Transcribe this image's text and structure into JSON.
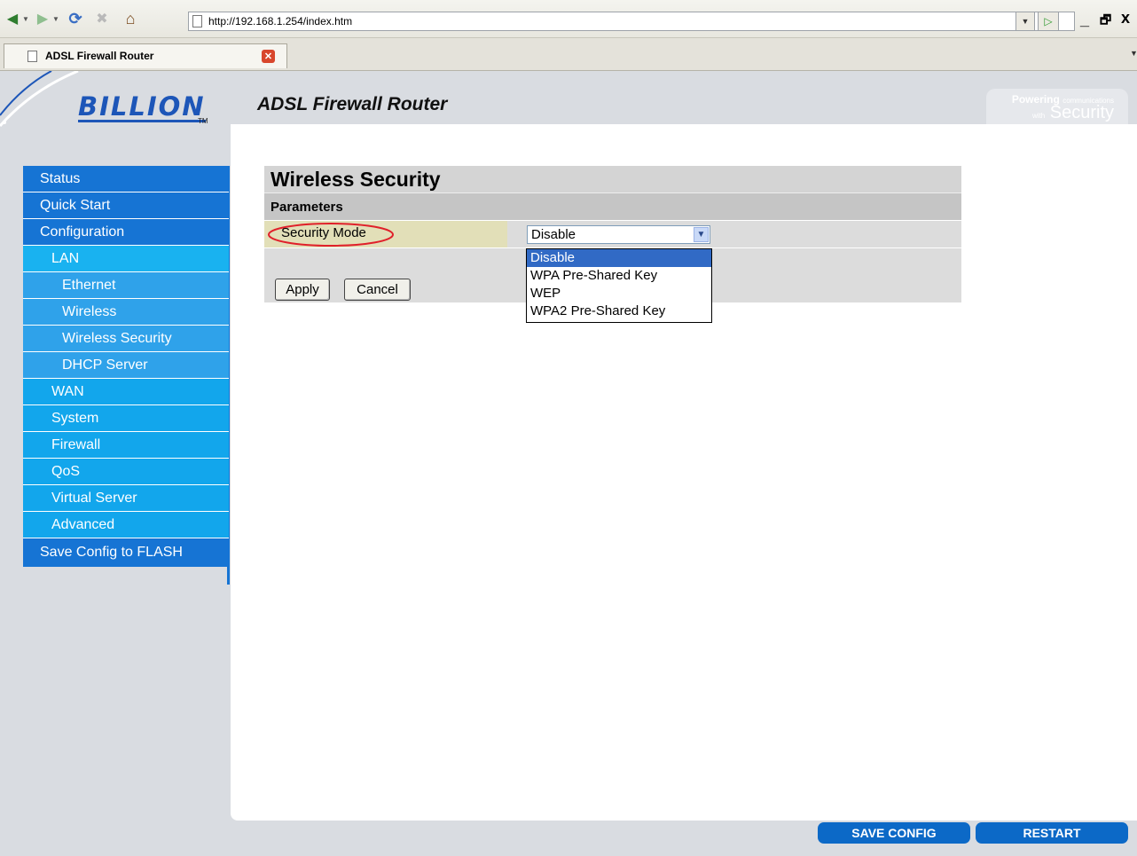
{
  "browser": {
    "url": "http://192.168.1.254/index.htm",
    "tab_title": "ADSL Firewall Router",
    "window_controls": {
      "minimize": "_",
      "maximize": "🗗",
      "close": "x"
    }
  },
  "header": {
    "logo": "BILLION",
    "logo_tm": "TM",
    "title": "ADSL Firewall Router",
    "slogan_line1_big": "Powering",
    "slogan_line1_small": "communications",
    "slogan_line2_small": "with",
    "slogan_line2_big": "Security"
  },
  "sidebar": {
    "items": [
      {
        "label": "Status"
      },
      {
        "label": "Quick Start"
      },
      {
        "label": "Configuration"
      },
      {
        "label": "LAN"
      },
      {
        "label": "Ethernet"
      },
      {
        "label": "Wireless"
      },
      {
        "label": "Wireless Security"
      },
      {
        "label": "DHCP Server"
      },
      {
        "label": "WAN"
      },
      {
        "label": "System"
      },
      {
        "label": "Firewall"
      },
      {
        "label": "QoS"
      },
      {
        "label": "Virtual Server"
      },
      {
        "label": "Advanced"
      },
      {
        "label": "Save Config to FLASH"
      }
    ]
  },
  "main": {
    "section_title": "Wireless Security",
    "parameters_heading": "Parameters",
    "security_mode_label": "Security Mode",
    "security_mode_value": "Disable",
    "options": [
      "Disable",
      "WPA Pre-Shared Key",
      "WEP",
      "WPA2 Pre-Shared Key"
    ],
    "apply_label": "Apply",
    "cancel_label": "Cancel"
  },
  "footer": {
    "save_config_label": "SAVE CONFIG",
    "restart_label": "RESTART"
  },
  "colors": {
    "sidebar_top": "#1674d4",
    "sidebar_sub": "#19b2f0",
    "sidebar_subsub": "#2fa2ea",
    "highlight_oval": "#e0202a",
    "selected_option": "#316ac5",
    "footer_button": "#0c69c7"
  }
}
